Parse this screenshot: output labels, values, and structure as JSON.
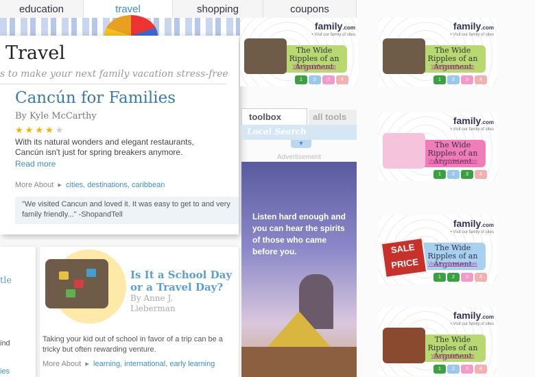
{
  "nav": {
    "tabs": [
      {
        "label": "education",
        "active": false
      },
      {
        "label": "travel",
        "active": true
      },
      {
        "label": "shopping",
        "active": false
      },
      {
        "label": "coupons",
        "active": false
      }
    ]
  },
  "main": {
    "section_title": "Travel",
    "tagline": "s to make your next family vacation stress-free",
    "article": {
      "title": "Cancún for Families",
      "byline": "By Kyle McCarthy",
      "rating": 4,
      "rating_max": 5,
      "summary": "With its natural wonders and elegant restaurants, Cancún isn't just for spring breakers anymore.",
      "read_more": "Read more",
      "more_about_label": "More About",
      "more_about_links": "cities, destinations, caribbean",
      "quote": "\"We visited Cancun and loved it. It was easy to get to and very family friendly...\" -ShopandTell"
    },
    "left_fragment": {
      "title": "tle",
      "text": "ind",
      "link": "ies"
    },
    "story": {
      "title": "Is It a School Day or a Travel Day?",
      "author": "By Anne J. Lieberman",
      "summary": "Taking your kid out of school in favor of a trip can be a tricky but often rewarding venture.",
      "more_about_label": "More About",
      "more_about_links": "learning, international, early learning"
    }
  },
  "toolbox": {
    "active_tab": "toolbox",
    "inactive_tab": "all tools",
    "local_search": "Local Search",
    "chevron": "▼"
  },
  "ad_label": "Advertisement",
  "skyscraper": {
    "text": "Listen hard enough and you can hear the spirits of those who came before you."
  },
  "ads": {
    "brand": "family",
    "brand_suffix": ".com",
    "tagline": "• Visit our family of sites",
    "headline": "The Wide Ripples of an Argument",
    "sale_text": "SALE PRICE",
    "pages": [
      "1",
      "2",
      "3",
      "4"
    ],
    "widgets": [
      {
        "visit": "Visit FamilyFun.com",
        "panel_color": "#b8d870",
        "active_page": "1",
        "variant": "suitcase"
      },
      {
        "visit": "Visit FamilyFun.com",
        "panel_color": "#b8d870",
        "active_page": "1",
        "variant": "suitcase"
      },
      {
        "visit": "Visit Familybabies.com",
        "panel_color": "#f07cb8",
        "active_page": "3",
        "variant": "pink"
      },
      {
        "visit": "Visit Familybabies.com",
        "panel_color": "#a8d0f0",
        "active_page": "2",
        "variant": "sale"
      },
      {
        "visit": "Visit FamilyFun.com",
        "panel_color": "#b8d870",
        "active_page": "1",
        "variant": "books"
      }
    ]
  },
  "colors": {
    "link": "#3a8fd0",
    "title": "#3a7aa8",
    "page_active": "#3aa040"
  }
}
